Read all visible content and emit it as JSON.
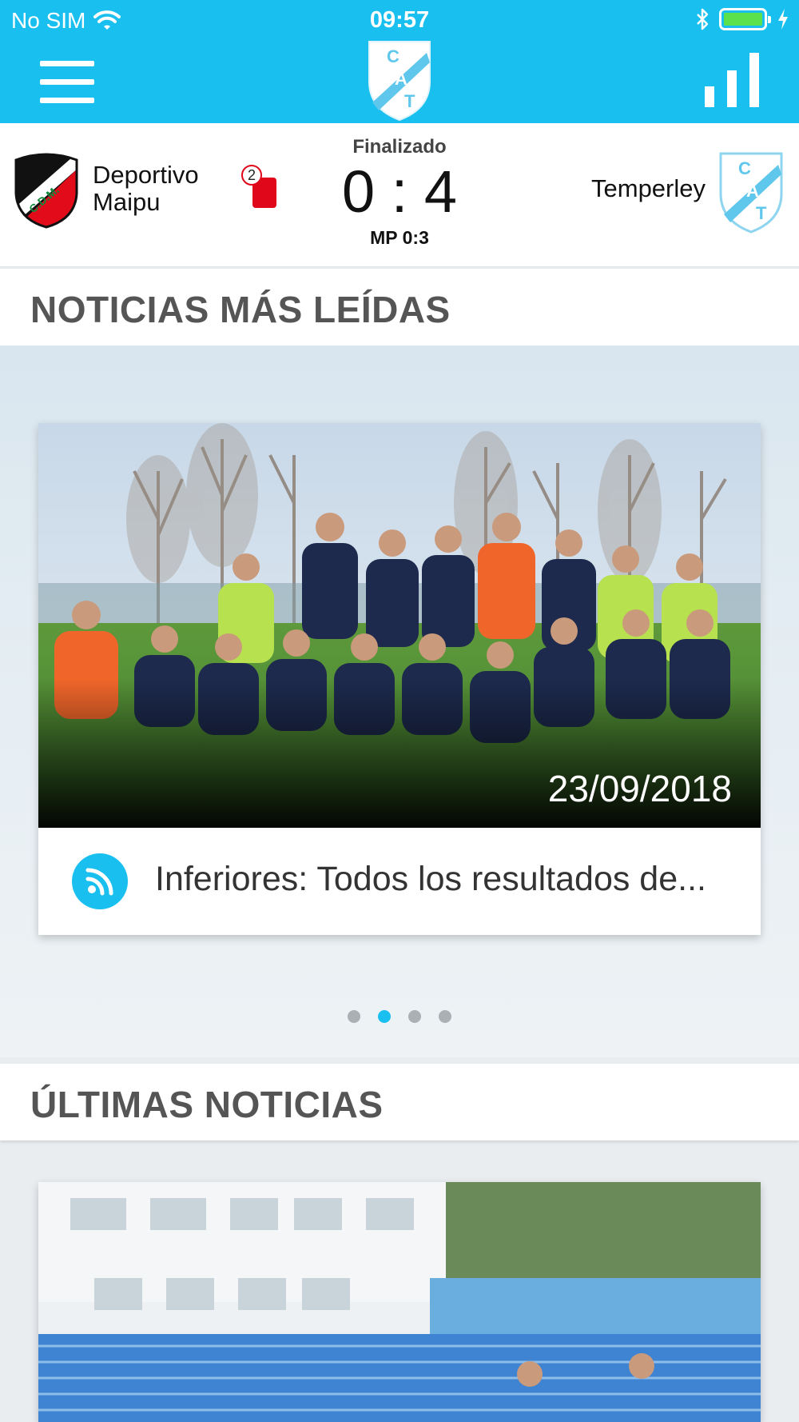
{
  "status_bar": {
    "carrier": "No SIM",
    "time": "09:57",
    "wifi_icon": "wifi-icon",
    "bluetooth_icon": "bluetooth-icon",
    "battery_level": 1.0
  },
  "header": {
    "menu_icon": "hamburger-menu-icon",
    "logo_letters": {
      "c": "C",
      "a": "A",
      "t": "T"
    },
    "stats_icon": "bar-chart-icon",
    "color": "#19c0ef"
  },
  "match": {
    "status": "Finalizado",
    "score": "0 : 4",
    "subscore": "MP 0:3",
    "home": {
      "name_line1": "Deportivo",
      "name_line2": "Maipu",
      "crest_letters": "C.D.M."
    },
    "away": {
      "name": "Temperley"
    },
    "red_cards": {
      "count": "2",
      "icon": "red-card-icon",
      "color": "#e1071a"
    }
  },
  "sections": {
    "most_read": "NOTICIAS MÁS LEÍDAS",
    "latest": "ÚLTIMAS NOTICIAS"
  },
  "featured": {
    "date": "23/09/2018",
    "title": "Inferiores: Todos los resultados de...",
    "icon": "rss-icon",
    "pager": {
      "count": 4,
      "active": 2
    }
  }
}
